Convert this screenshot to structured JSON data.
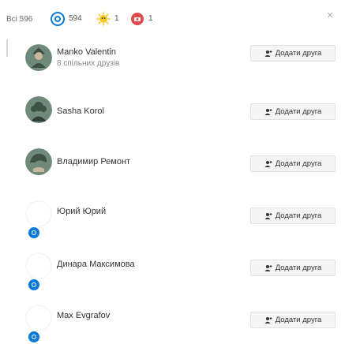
{
  "header": {
    "all_filter": "Всі 596",
    "filters": [
      {
        "icon": "odnoklassniki-icon",
        "count": "594"
      },
      {
        "icon": "sun-icon",
        "count": "1"
      },
      {
        "icon": "camera-icon",
        "count": "1"
      }
    ],
    "close_icon": "×"
  },
  "colors": {
    "ok_orange": "#ee8208",
    "sun_yellow": "#f3c623",
    "camera_red": "#e04b4b",
    "badge_blue": "#0a7ad6",
    "avatar_gray": "#6f8a78"
  },
  "friends": [
    {
      "name": "Manko Valentin",
      "mutual": "8 спільних друзів",
      "button": "Додати друга",
      "avatar": "photo"
    },
    {
      "name": "Sasha Korol",
      "mutual": "",
      "button": "Додати друга",
      "avatar": "photo"
    },
    {
      "name": "Владимир Ремонт",
      "mutual": "",
      "button": "Додати друга",
      "avatar": "photo"
    },
    {
      "name": "Юрий Юрий",
      "mutual": "",
      "button": "Додати друга",
      "avatar": "empty"
    },
    {
      "name": "Динара Максимова",
      "mutual": "",
      "button": "Додати друга",
      "avatar": "empty"
    },
    {
      "name": "Max Evgrafov",
      "mutual": "",
      "button": "Додати друга",
      "avatar": "empty"
    }
  ]
}
